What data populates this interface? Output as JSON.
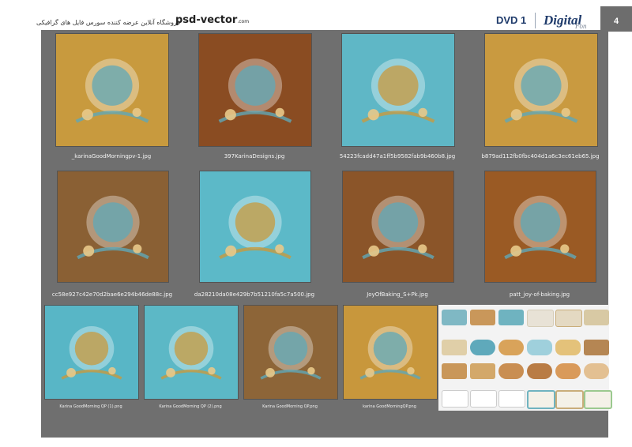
{
  "header": {
    "persian_text": "فروشگاه آنلاین عرضه کننده سورس فایل های گرافیکی",
    "logo_text": "psd-vector",
    "logo_suffix": ".com",
    "dvd_label": "DVD 1",
    "brand_main": "Digital",
    "brand_script": "Fon",
    "page_number": "4"
  },
  "thumbnails": [
    {
      "caption": "_karinaGoodMorningpv-1.jpg",
      "base": "#c89a3e",
      "accent": "#5fa8b8"
    },
    {
      "caption": "397KarinaDesigns.jpg",
      "base": "#8a4c22",
      "accent": "#5fa8b8"
    },
    {
      "caption": "54223fcadd47a1ff5b9582fab9b460b8.jpg",
      "base": "#5fb7c6",
      "accent": "#c89a3e"
    },
    {
      "caption": "b879ad112fb0fbc404d1a6c3ec61eb65.jpg",
      "base": "#c99a40",
      "accent": "#5fa8b8"
    },
    {
      "caption": "cc58e927c42e70d2bae6e294b46de88c.jpg",
      "base": "#8a6034",
      "accent": "#5fa8b8"
    },
    {
      "caption": "da28210da08e429b7b51210fa5c7a500.jpg",
      "base": "#5cb9c8",
      "accent": "#c89a3e"
    },
    {
      "caption": "JoyOfBaking_S+Pk.jpg",
      "base": "#8b5529",
      "accent": "#5fa8b8"
    },
    {
      "caption": "patt_joy-of-baking.jpg",
      "base": "#9a5a24",
      "accent": "#5fa8b8"
    },
    {
      "caption": "Karina GoodMorning QP (1).png",
      "base": "#58b6c6",
      "accent": "#c89a3e"
    },
    {
      "caption": "Karina GoodMorning QP (2).png",
      "base": "#5cb8c6",
      "accent": "#c89a3e"
    },
    {
      "caption": "Karina GoodMorning QP.png",
      "base": "#8d6538",
      "accent": "#5fa8b8"
    },
    {
      "caption": "karina GoodMorningQP.png",
      "base": "#c8973c",
      "accent": "#5fa8b8"
    }
  ]
}
